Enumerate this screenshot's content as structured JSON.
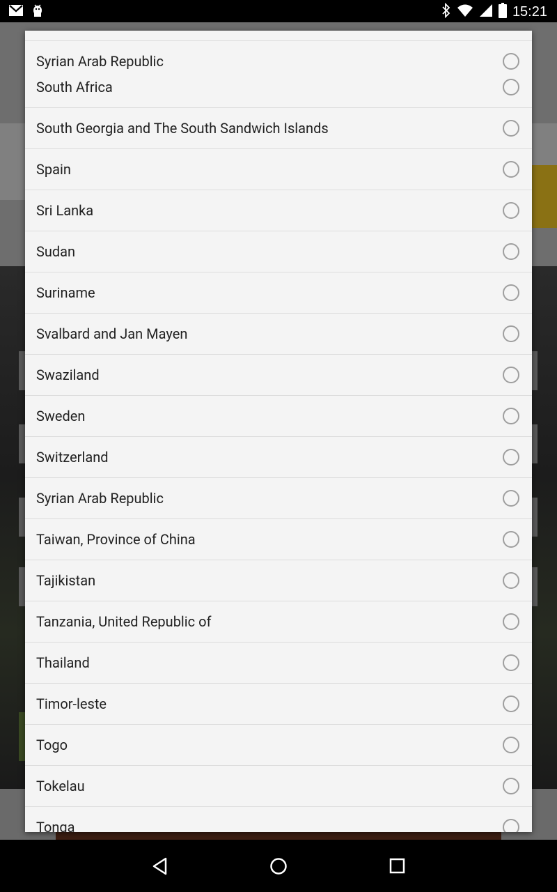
{
  "status_bar": {
    "time": "15:21",
    "left_icons": [
      "gmail-icon",
      "android-debug-icon"
    ],
    "right_icons": [
      "bluetooth-icon",
      "wifi-icon",
      "cellular-signal-icon",
      "battery-icon"
    ]
  },
  "dialog": {
    "items": [
      {
        "label": "Syrian Arab Republic",
        "selected": false
      },
      {
        "label": "South Africa",
        "selected": false
      },
      {
        "label": "South Georgia and The South Sandwich Islands",
        "selected": false
      },
      {
        "label": "Spain",
        "selected": false
      },
      {
        "label": "Sri Lanka",
        "selected": false
      },
      {
        "label": "Sudan",
        "selected": false
      },
      {
        "label": "Suriname",
        "selected": false
      },
      {
        "label": "Svalbard and Jan Mayen",
        "selected": false
      },
      {
        "label": "Swaziland",
        "selected": false
      },
      {
        "label": "Sweden",
        "selected": false
      },
      {
        "label": "Switzerland",
        "selected": false
      },
      {
        "label": "Syrian Arab Republic",
        "selected": false
      },
      {
        "label": "Taiwan, Province of China",
        "selected": false
      },
      {
        "label": "Tajikistan",
        "selected": false
      },
      {
        "label": "Tanzania, United Republic of",
        "selected": false
      },
      {
        "label": "Thailand",
        "selected": false
      },
      {
        "label": "Timor-leste",
        "selected": false
      },
      {
        "label": "Togo",
        "selected": false
      },
      {
        "label": "Tokelau",
        "selected": false
      },
      {
        "label": "Tonga",
        "selected": false
      }
    ]
  },
  "nav_bar": {
    "buttons": [
      "back-icon",
      "home-icon",
      "recents-icon"
    ]
  },
  "colors": {
    "dialog_bg": "#f4f4f4",
    "divider": "#dcdcdc",
    "text": "#212121",
    "radio_border": "#9e9e9e"
  }
}
